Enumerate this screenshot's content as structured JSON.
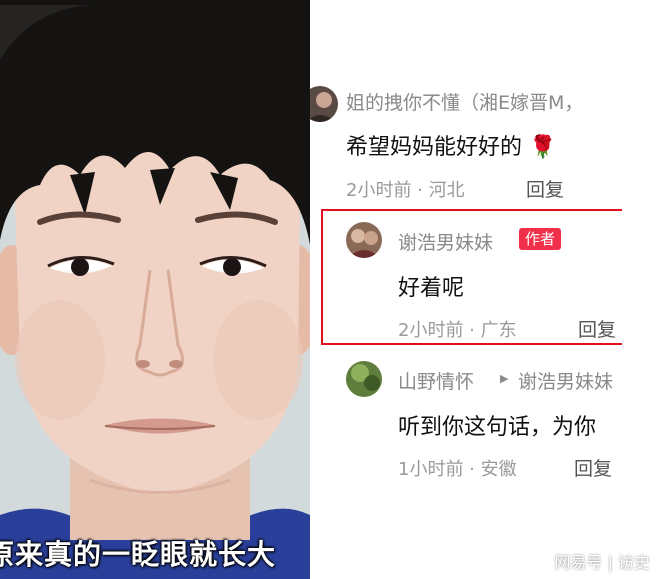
{
  "photo": {
    "caption": "原来真的一眨眼就长大"
  },
  "comments": [
    {
      "username": "姐的拽你不懂（湘E嫁晋M，",
      "text": "希望妈妈能好好的",
      "emoji": "🌹",
      "meta": "2小时前 · 河北",
      "reply": "回复"
    },
    {
      "username": "谢浩男妹妹",
      "badge": "作者",
      "text": "好着呢",
      "meta": "2小时前 · 广东",
      "reply": "回复"
    },
    {
      "username": "山野情怀",
      "reply_to": "谢浩男妹妹",
      "text": "听到你这句话，为你",
      "meta": "1小时前 · 安徽",
      "reply": "回复"
    }
  ],
  "watermark": "网易号 | 访史",
  "colors": {
    "badge": "#f0304b",
    "highlight_border": "#e2101f"
  }
}
